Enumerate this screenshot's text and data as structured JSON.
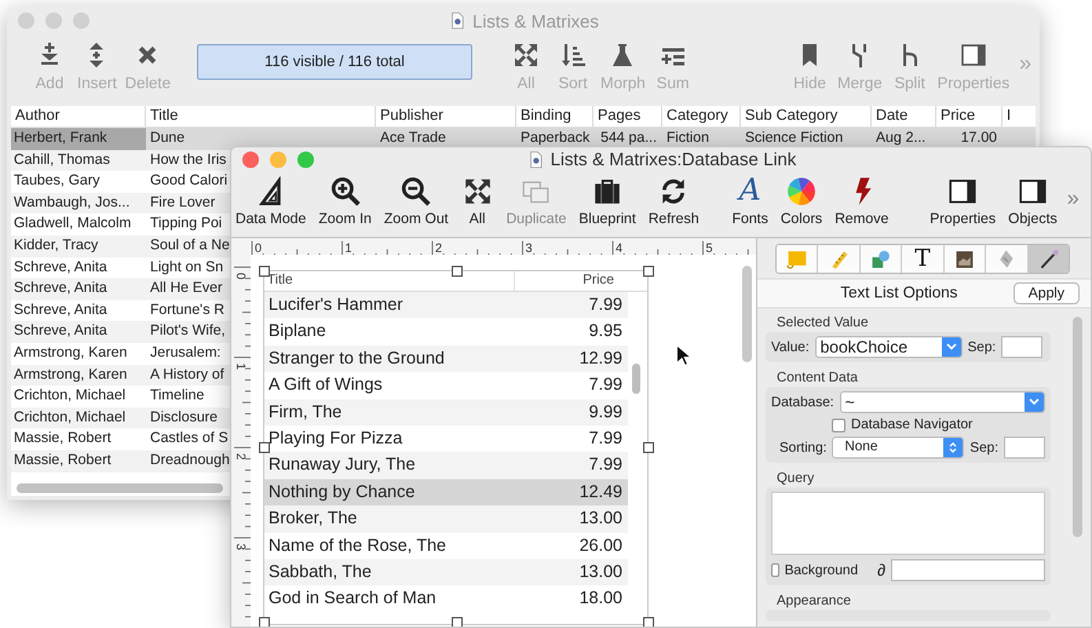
{
  "back_window": {
    "title": "Lists & Matrixes",
    "toolbar_left": [
      {
        "label": "Add"
      },
      {
        "label": "Insert"
      },
      {
        "label": "Delete"
      }
    ],
    "status": "116 visible / 116 total",
    "toolbar_middle": [
      {
        "label": "All"
      },
      {
        "label": "Sort"
      },
      {
        "label": "Morph"
      },
      {
        "label": "Sum"
      }
    ],
    "toolbar_right": [
      {
        "label": "Hide"
      },
      {
        "label": "Merge"
      },
      {
        "label": "Split"
      },
      {
        "label": "Properties"
      }
    ],
    "overflow": "»",
    "table": {
      "columns": [
        "Author",
        "Title",
        "Publisher",
        "Binding",
        "Pages",
        "Category",
        "Sub Category",
        "Date",
        "Price",
        "I"
      ],
      "rows": [
        {
          "cells": [
            "Herbert, Frank",
            "Dune",
            "Ace Trade",
            "Paperback",
            "544 pa...",
            "Fiction",
            "Science Fiction",
            "Aug 2...",
            "17.00"
          ],
          "selected": true
        },
        {
          "cells": [
            "Cahill, Thomas",
            "How the Iris"
          ],
          "selected": false
        },
        {
          "cells": [
            "Taubes, Gary",
            "Good Calori"
          ],
          "selected": false
        },
        {
          "cells": [
            "Wambaugh, Jos...",
            "Fire Lover"
          ],
          "selected": false
        },
        {
          "cells": [
            "Gladwell, Malcolm",
            "Tipping Poi"
          ],
          "selected": false
        },
        {
          "cells": [
            "Kidder, Tracy",
            "Soul of a Ne"
          ],
          "selected": false
        },
        {
          "cells": [
            "Schreve, Anita",
            "Light on Sn"
          ],
          "selected": false
        },
        {
          "cells": [
            "Schreve, Anita",
            "All He Ever"
          ],
          "selected": false
        },
        {
          "cells": [
            "Schreve, Anita",
            "Fortune's R"
          ],
          "selected": false
        },
        {
          "cells": [
            "Schreve, Anita",
            "Pilot's Wife,"
          ],
          "selected": false
        },
        {
          "cells": [
            "Armstrong, Karen",
            "Jerusalem:"
          ],
          "selected": false
        },
        {
          "cells": [
            "Armstrong, Karen",
            "A History of"
          ],
          "selected": false
        },
        {
          "cells": [
            "Crichton, Michael",
            "Timeline"
          ],
          "selected": false
        },
        {
          "cells": [
            "Crichton, Michael",
            "Disclosure"
          ],
          "selected": false
        },
        {
          "cells": [
            "Massie, Robert",
            "Castles of S"
          ],
          "selected": false
        },
        {
          "cells": [
            "Massie, Robert",
            "Dreadnough"
          ],
          "selected": false
        }
      ]
    }
  },
  "front_window": {
    "title": "Lists & Matrixes:Database Link",
    "toolbar": [
      [
        {
          "label": "Data Mode",
          "disabled": false
        },
        {
          "label": "Zoom In",
          "disabled": false
        },
        {
          "label": "Zoom Out",
          "disabled": false
        },
        {
          "label": "All",
          "disabled": false
        },
        {
          "label": "Duplicate",
          "disabled": true
        },
        {
          "label": "Blueprint",
          "disabled": false
        },
        {
          "label": "Refresh",
          "disabled": false
        }
      ],
      [
        {
          "label": "Fonts",
          "glyph": "A",
          "disabled": false
        },
        {
          "label": "Colors",
          "disabled": false
        },
        {
          "label": "Remove",
          "disabled": false
        }
      ],
      [
        {
          "label": "Properties",
          "disabled": false
        },
        {
          "label": "Objects",
          "disabled": false
        }
      ]
    ],
    "overflow": "»",
    "rulers": {
      "horizontal": [
        "0",
        "1",
        "2",
        "3",
        "4",
        "5"
      ],
      "vertical": [
        "0",
        "1",
        "2",
        "3"
      ]
    },
    "list": {
      "columns": [
        "Title",
        "Price"
      ],
      "rows": [
        {
          "title": "Lucifer's Hammer",
          "price": "7.99",
          "selected": false
        },
        {
          "title": "Biplane",
          "price": "9.95",
          "selected": false
        },
        {
          "title": "Stranger to the Ground",
          "price": "12.99",
          "selected": false
        },
        {
          "title": "A Gift of Wings",
          "price": "7.99",
          "selected": false
        },
        {
          "title": "Firm, The",
          "price": "9.99",
          "selected": false
        },
        {
          "title": "Playing For Pizza",
          "price": "7.99",
          "selected": false
        },
        {
          "title": "Runaway Jury, The",
          "price": "7.99",
          "selected": false
        },
        {
          "title": "Nothing by Chance",
          "price": "12.49",
          "selected": true
        },
        {
          "title": "Broker, The",
          "price": "13.00",
          "selected": false
        },
        {
          "title": "Name of the Rose, The",
          "price": "26.00",
          "selected": false
        },
        {
          "title": "Sabbath, The",
          "price": "13.00",
          "selected": false
        },
        {
          "title": "God in Search of Man",
          "price": "18.00",
          "selected": false
        }
      ]
    },
    "inspector": {
      "tabs": [
        {
          "selected": false
        },
        {
          "selected": false
        },
        {
          "selected": false
        },
        {
          "glyph": "T",
          "selected": false
        },
        {
          "selected": false
        },
        {
          "selected": false
        },
        {
          "selected": true
        }
      ],
      "heading": "Text List Options",
      "apply": "Apply",
      "selected_value": {
        "title": "Selected Value",
        "value_label": "Value:",
        "value": "bookChoice",
        "sep_label": "Sep:"
      },
      "content_data": {
        "title": "Content Data",
        "database_label": "Database:",
        "database": "~",
        "navigator": {
          "label": "Database Navigator",
          "checked": false
        },
        "sorting_label": "Sorting:",
        "sorting": "None",
        "sep_label": "Sep:"
      },
      "query": {
        "title": "Query",
        "background": {
          "label": "Background",
          "checked": false
        },
        "variable_glyph": "∂"
      },
      "appearance": {
        "title": "Appearance"
      }
    }
  }
}
